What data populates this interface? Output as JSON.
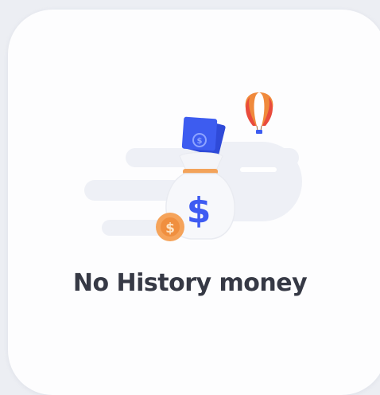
{
  "empty_state": {
    "title": "No History money",
    "illustration": {
      "bag_symbol": "$",
      "coin_symbol": "$",
      "icons": [
        "money-bag-icon",
        "banknote-icon",
        "coin-icon",
        "hot-air-balloon-icon"
      ]
    }
  },
  "colors": {
    "card_background": "#fdfdfe",
    "page_background": "#eceef3",
    "title_text": "#363945",
    "cloud": "#eef0f6",
    "banknote": "#3d5cf0",
    "dollar_sign": "#3e5bf2",
    "bag_band": "#f3a35a",
    "coin": "#f5a35a",
    "balloon_orange": "#f08a3c",
    "balloon_red": "#e94b3c"
  }
}
